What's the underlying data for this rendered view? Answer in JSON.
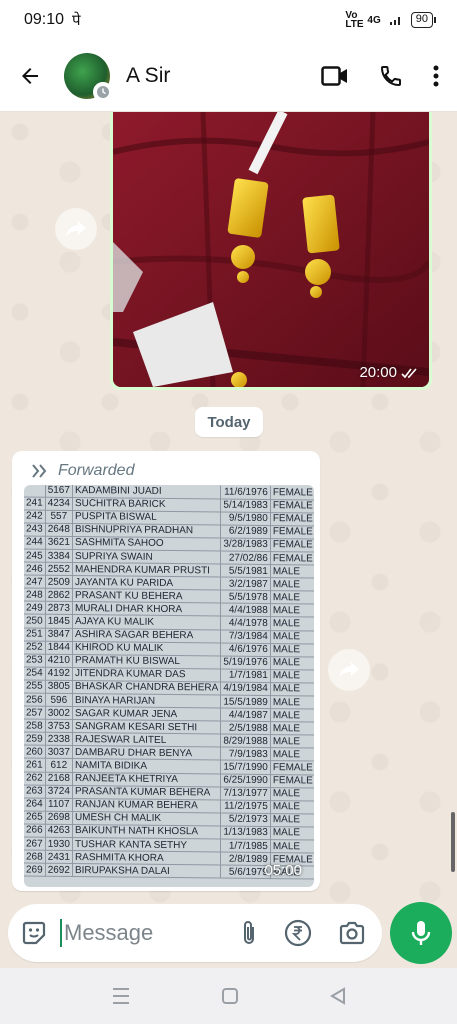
{
  "status": {
    "time": "09:10",
    "carrier_icon": "पे",
    "net1": "Vo LTE",
    "net2": "4G",
    "battery": "90"
  },
  "header": {
    "contact_name": "A Sir"
  },
  "messages": {
    "image1_time": "20:00",
    "date_chip": "Today",
    "forwarded_label": "Forwarded",
    "doc_time": "05:00",
    "doc_rows": [
      [
        "",
        "5167",
        "KADAMBINI JUADI",
        "11/6/1976",
        "FEMALE"
      ],
      [
        "241",
        "4234",
        "SUCHITRA BARICK",
        "5/14/1983",
        "FEMALE"
      ],
      [
        "242",
        "557",
        "PUSPITA BISWAL",
        "9/5/1980",
        "FEMALE"
      ],
      [
        "243",
        "2648",
        "BISHNUPRIYA PRADHAN",
        "6/2/1989",
        "FEMALE"
      ],
      [
        "244",
        "3621",
        "SASHMITA SAHOO",
        "3/28/1983",
        "FEMALE"
      ],
      [
        "245",
        "3384",
        "SUPRIYA SWAIN",
        "27/02/86",
        "FEMALE"
      ],
      [
        "246",
        "2552",
        "MAHENDRA KUMAR PRUSTI",
        "5/5/1981",
        "MALE"
      ],
      [
        "247",
        "2509",
        "JAYANTA KU PARIDA",
        "3/2/1987",
        "MALE"
      ],
      [
        "248",
        "2862",
        "PRASANT KU BEHERA",
        "5/5/1978",
        "MALE"
      ],
      [
        "249",
        "2873",
        "MURALI DHAR KHORA",
        "4/4/1988",
        "MALE"
      ],
      [
        "250",
        "1845",
        "AJAYA KU MALIK",
        "4/4/1978",
        "MALE"
      ],
      [
        "251",
        "3847",
        "ASHIRA SAGAR BEHERA",
        "7/3/1984",
        "MALE"
      ],
      [
        "252",
        "1844",
        "KHIROD KU MALIK",
        "4/6/1976",
        "MALE"
      ],
      [
        "253",
        "4210",
        "PRAMATH KU BISWAL",
        "5/19/1976",
        "MALE"
      ],
      [
        "254",
        "4192",
        "JITENDRA KUMAR DAS",
        "1/7/1981",
        "MALE"
      ],
      [
        "255",
        "3805",
        "BHASKAR CHANDRA BEHERA",
        "4/19/1984",
        "MALE"
      ],
      [
        "256",
        "596",
        "BINAYA HARIJAN",
        "15/5/1989",
        "MALE"
      ],
      [
        "257",
        "3002",
        "SAGAR KUMAR JENA",
        "4/4/1987",
        "MALE"
      ],
      [
        "258",
        "3753",
        "SANGRAM KESARI SETHI",
        "2/5/1988",
        "MALE"
      ],
      [
        "259",
        "2338",
        "RAJESWAR LAITEL",
        "8/29/1988",
        "MALE"
      ],
      [
        "260",
        "3037",
        "DAMBARU DHAR BENYA",
        "7/9/1983",
        "MALE"
      ],
      [
        "261",
        "612",
        "NAMITA BIDIKA",
        "15/7/1990",
        "FEMALE"
      ],
      [
        "262",
        "2168",
        "RANJEETA KHETRIYA",
        "6/25/1990",
        "FEMALE"
      ],
      [
        "263",
        "3724",
        "PRASANTA KUMAR BEHERA",
        "7/13/1977",
        "MALE"
      ],
      [
        "264",
        "1107",
        "RANJAN KUMAR BEHERA",
        "11/2/1975",
        "MALE"
      ],
      [
        "265",
        "2698",
        "UMESH CH MALIK",
        "5/2/1973",
        "MALE"
      ],
      [
        "266",
        "4263",
        "BAIKUNTH NATH KHOSLA",
        "1/13/1983",
        "MALE"
      ],
      [
        "267",
        "1930",
        "TUSHAR KANTA SETHY",
        "1/7/1985",
        "MALE"
      ],
      [
        "268",
        "2431",
        "RASHMITA KHORA",
        "2/8/1989",
        "FEMALE"
      ],
      [
        "269",
        "2692",
        "BIRUPAKSHA DALAI",
        "5/6/1979",
        "MALE"
      ]
    ]
  },
  "composer": {
    "placeholder": "Message"
  },
  "colors": {
    "accent": "#1bad5c",
    "outgoing_bubble": "#d9fdd3"
  }
}
